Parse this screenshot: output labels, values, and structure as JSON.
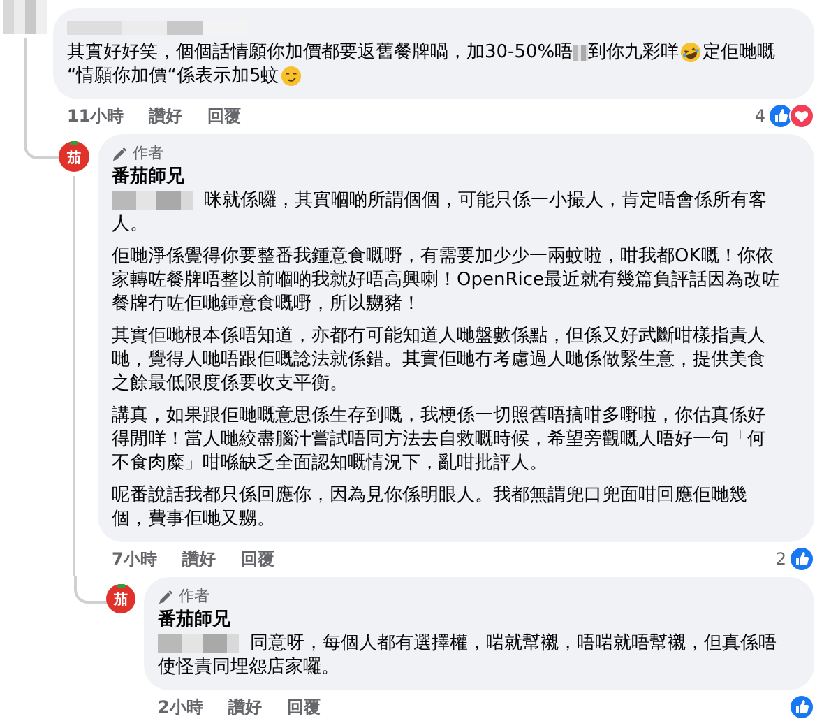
{
  "comments": [
    {
      "avatar": {
        "kind": "blurred"
      },
      "author": {
        "kind": "blurred"
      },
      "paragraphs": [
        [
          [
            {
              "kind": "text",
              "text": "其實好好笑，個個話情願你加價都要返舊餐牌喎，加30-50%唔"
            },
            {
              "kind": "mask"
            },
            {
              "kind": "text",
              "text": "到你九彩咩"
            },
            {
              "kind": "laugh"
            },
            {
              "kind": "text",
              "text": "定佢哋嘅"
            }
          ],
          [
            {
              "kind": "text",
              "text": "“情願你加價“係表示加5蚊"
            },
            {
              "kind": "smirk"
            }
          ]
        ]
      ],
      "time": "11小時",
      "actions": [
        "讚好",
        "回覆"
      ],
      "reactions": {
        "count": "4",
        "icons": [
          {
            "kind": "like"
          },
          {
            "kind": "love"
          }
        ]
      },
      "replies": [
        {
          "avatar": {
            "kind": "logo",
            "text": "茄"
          },
          "badge": "作者",
          "author": {
            "kind": "name",
            "text": "番茄師兄"
          },
          "paragraphs": [
            [
              [
                {
                  "kind": "namemask"
                },
                {
                  "kind": "text",
                  "text": "咪就係囉，其實嗰啲所謂個個，可能只係一小撮人，肯定唔會係所有客"
                }
              ],
              [
                {
                  "kind": "text",
                  "text": "人。"
                }
              ]
            ],
            [
              [
                {
                  "kind": "text",
                  "text": "佢哋淨係覺得你要整番我鍾意食嘅嘢，有需要加少少一兩蚊啦，咁我都OK嘅！你依"
                }
              ],
              [
                {
                  "kind": "text",
                  "text": "家轉咗餐牌唔整以前嗰啲我就好唔高興喇！OpenRice最近就有幾篇負評話因為改咗"
                }
              ],
              [
                {
                  "kind": "text",
                  "text": "餐牌冇咗佢哋鍾意食嘅嘢，所以嬲豬！"
                }
              ]
            ],
            [
              [
                {
                  "kind": "text",
                  "text": "其實佢哋根本係唔知道，亦都冇可能知道人哋盤數係點，但係又好武斷咁樣指責人"
                }
              ],
              [
                {
                  "kind": "text",
                  "text": "哋，覺得人哋唔跟佢嘅諗法就係錯。其實佢哋冇考慮過人哋係做緊生意，提供美食"
                }
              ],
              [
                {
                  "kind": "text",
                  "text": "之餘最低限度係要收支平衡。"
                }
              ]
            ],
            [
              [
                {
                  "kind": "text",
                  "text": "講真，如果跟佢哋嘅意思係生存到嘅，我梗係一切照舊唔搞咁多嘢啦，你估真係好"
                }
              ],
              [
                {
                  "kind": "text",
                  "text": "得閒咩！當人哋絞盡腦汁嘗試唔同方法去自救嘅時候，希望旁觀嘅人唔好一句「何"
                }
              ],
              [
                {
                  "kind": "text",
                  "text": "不食肉糜」咁喺缺乏全面認知嘅情況下，亂咁批評人。"
                }
              ]
            ],
            [
              [
                {
                  "kind": "text",
                  "text": "呢番說話我都只係回應你，因為見你係明眼人。我都無謂兜口兜面咁回應佢哋幾"
                }
              ],
              [
                {
                  "kind": "text",
                  "text": "個，費事佢哋又嬲。"
                }
              ]
            ]
          ],
          "time": "7小時",
          "actions": [
            "讚好",
            "回覆"
          ],
          "reactions": {
            "count": "2",
            "icons": [
              {
                "kind": "like"
              }
            ]
          },
          "replies": [
            {
              "avatar": {
                "kind": "logo",
                "text": "茄"
              },
              "badge": "作者",
              "author": {
                "kind": "name",
                "text": "番茄師兄"
              },
              "paragraphs": [
                [
                  [
                    {
                      "kind": "namemask"
                    },
                    {
                      "kind": "text",
                      "text": "同意呀，每個人都有選擇權，啱就幫襯，唔啱就唔幫襯，但真係唔"
                    }
                  ],
                  [
                    {
                      "kind": "text",
                      "text": "使怪責同埋怨店家囉。"
                    }
                  ]
                ]
              ],
              "time": "2小時",
              "actions": [
                "讚好",
                "回覆"
              ],
              "reactions": {
                "icons": [
                  {
                    "kind": "like"
                  }
                ]
              }
            }
          ]
        }
      ]
    }
  ]
}
